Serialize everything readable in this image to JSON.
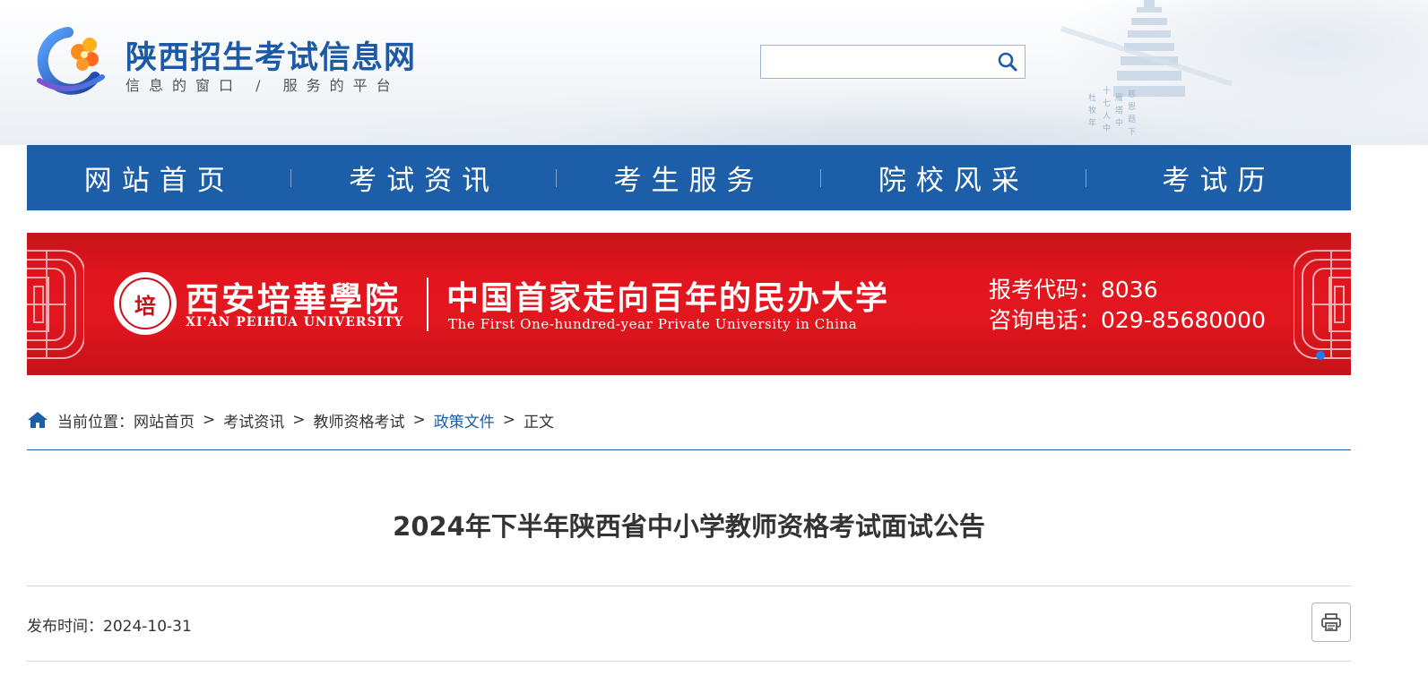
{
  "site": {
    "title": "陕西招生考试信息网",
    "slogan": "信息的窗口 / 服务的平台"
  },
  "search": {
    "value": "",
    "icon": "search-icon"
  },
  "colors": {
    "brand_blue": "#1c5ea8",
    "banner_red": "#e0151d",
    "text": "#333333"
  },
  "nav": {
    "items": [
      {
        "label": "网站首页"
      },
      {
        "label": "考试资讯"
      },
      {
        "label": "考生服务"
      },
      {
        "label": "院校风采"
      },
      {
        "label": "考试历"
      }
    ]
  },
  "banner": {
    "seal_text": "培",
    "university_cn": "西安培華學院",
    "university_en": "XI'AN PEIHUA UNIVERSITY",
    "slogan_cn": "中国首家走向百年的民办大学",
    "slogan_en": "The First One-hundred-year Private University in China",
    "code_line": "报考代码：8036",
    "phone_line": "咨询电话：029-85680000"
  },
  "breadcrumb": {
    "icon": "home-icon",
    "prefix": "当前位置：",
    "items": [
      {
        "label": "网站首页"
      },
      {
        "label": "考试资讯"
      },
      {
        "label": "教师资格考试"
      },
      {
        "label": "政策文件"
      },
      {
        "label": "正文"
      }
    ],
    "separator": ">"
  },
  "article": {
    "title": "2024年下半年陕西省中小学教师资格考试面试公告",
    "publish_label": "发布时间：",
    "publish_date": "2024-10-31",
    "print_icon": "printer-icon"
  }
}
